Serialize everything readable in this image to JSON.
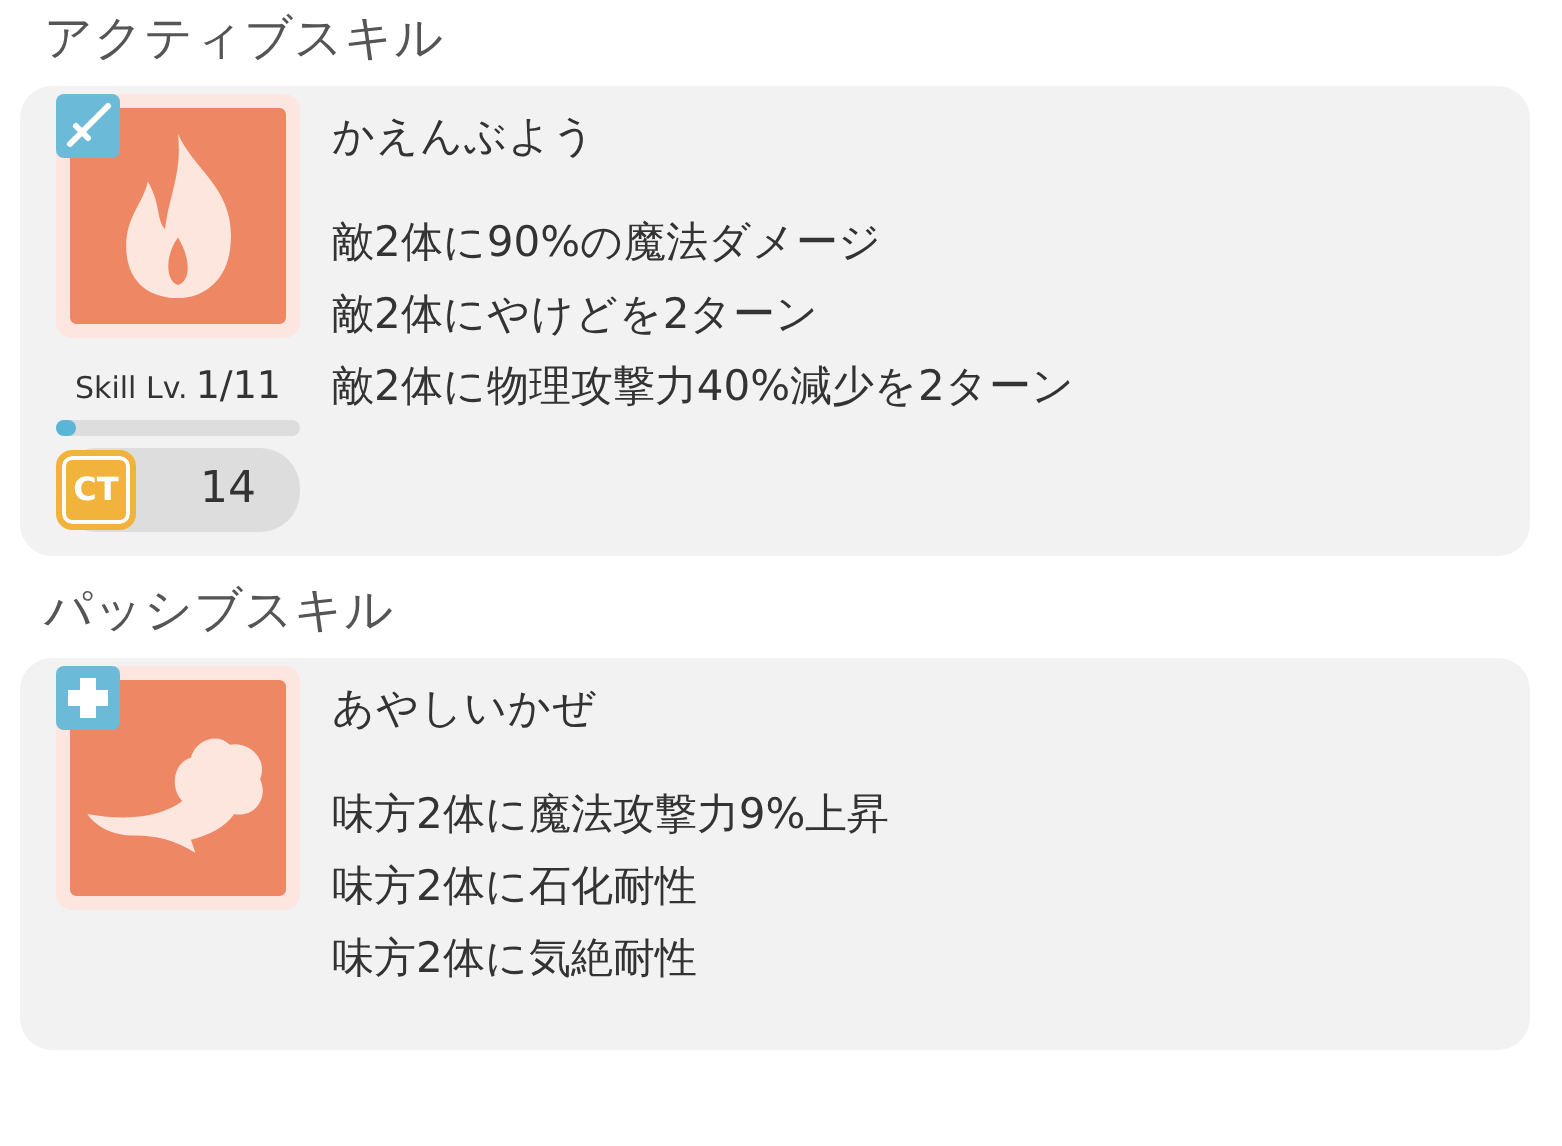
{
  "sections": [
    {
      "title": "アクティブスキル",
      "skill": {
        "kind": "active",
        "name": "かえんぶよう",
        "effects": [
          "敵2体に90%の魔法ダメージ",
          "敵2体にやけどを2ターン",
          "敵2体に物理攻撃力40%減少を2ターン"
        ],
        "level_label": "Skill Lv.",
        "level_value": "1/11",
        "level": 0.08,
        "ct_label": "CT",
        "ct_value": "14"
      }
    },
    {
      "title": "パッシブスキル",
      "skill": {
        "kind": "passive",
        "name": "あやしいかぜ",
        "effects": [
          "味方2体に魔法攻撃力9%上昇",
          "味方2体に石化耐性",
          "味方2体に気絶耐性"
        ]
      }
    }
  ]
}
